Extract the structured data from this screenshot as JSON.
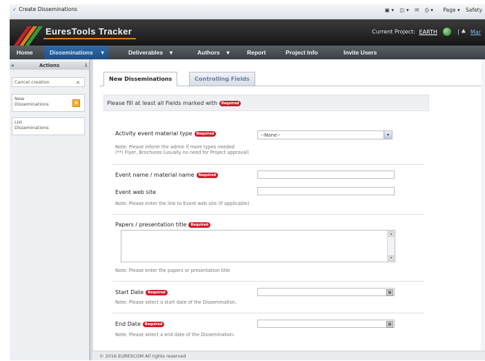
{
  "browser": {
    "tab_title": "Create Disseminations",
    "tools": [
      "Page",
      "Safety"
    ]
  },
  "app": {
    "title": "EuresTools Tracker",
    "current_project_label": "Current Project:",
    "current_project": "EARTH",
    "user_link": "Mar"
  },
  "nav": {
    "items": [
      "Home",
      "Disseminations",
      "Deliverables",
      "Authors",
      "Report",
      "Project Info",
      "Invite Users"
    ],
    "active": "Disseminations"
  },
  "sidebar": {
    "header": "Actions",
    "items": [
      {
        "label": "Cancel creation"
      },
      {
        "line1": "New",
        "line2": "Disseminations"
      },
      {
        "line1": "List",
        "line2": "Disseminations"
      }
    ]
  },
  "tabs": {
    "active": "New Disseminations",
    "inactive": "Controlling Fields"
  },
  "form": {
    "notice": "Please fill at least all Fields marked with",
    "required_badge": "Required",
    "activity_type": {
      "label": "Activity event material type",
      "value": "--None--",
      "note1": "Note: Please inform the admin if more types needed",
      "note2": "(**) Flyer, Brochures (usually no need for Project approval)"
    },
    "event_name": {
      "label": "Event name / material name"
    },
    "event_web": {
      "label": "Event web site",
      "note": "Note: Please enter the link to Event web site (if applicable)"
    },
    "papers": {
      "label": "Papers / presentation title",
      "note": "Note: Please enter the papers or presentation title"
    },
    "start_date": {
      "label": "Start Date",
      "note": "Note: Please select a start date of the Dissemination."
    },
    "end_date": {
      "label": "End Date",
      "note": "Note: Please select a end date of the Dissemination."
    }
  },
  "footer": {
    "text": "© 2016 EURESCOM All rights reserved"
  },
  "colors": {
    "nav_active": "#1e4f86",
    "required": "#c8202a",
    "banner": "#161616"
  }
}
